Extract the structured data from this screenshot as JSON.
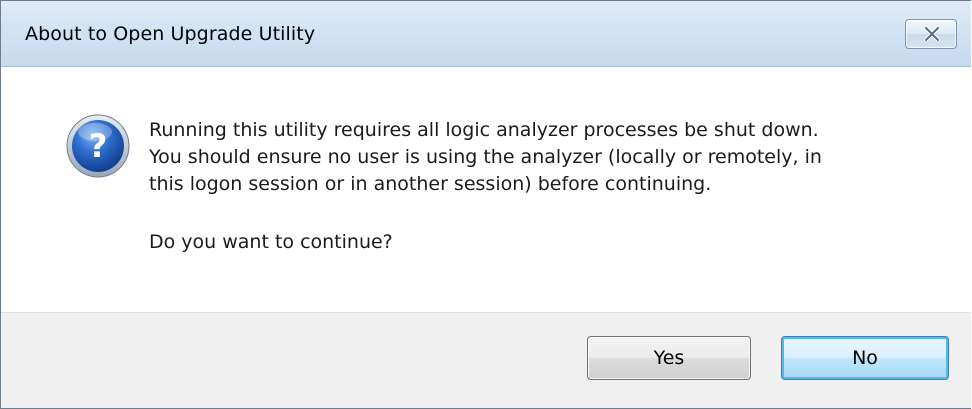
{
  "window": {
    "title": "About to Open Upgrade Utility",
    "close_icon": "close-icon"
  },
  "dialog": {
    "icon": "question-icon",
    "message_lines": [
      "Running this utility requires all logic analyzer processes be shut down.",
      "You should ensure no user is using the analyzer (locally or remotely, in",
      "this logon session or in another session) before continuing."
    ],
    "question": "Do you want to continue?"
  },
  "buttons": {
    "yes_label": "Yes",
    "no_label": "No"
  },
  "colors": {
    "titlebar": "#d3e3f3",
    "footer": "#f0f0f0",
    "default_button_border": "#3c7fb1",
    "icon_blue": "#1f5fbf"
  }
}
